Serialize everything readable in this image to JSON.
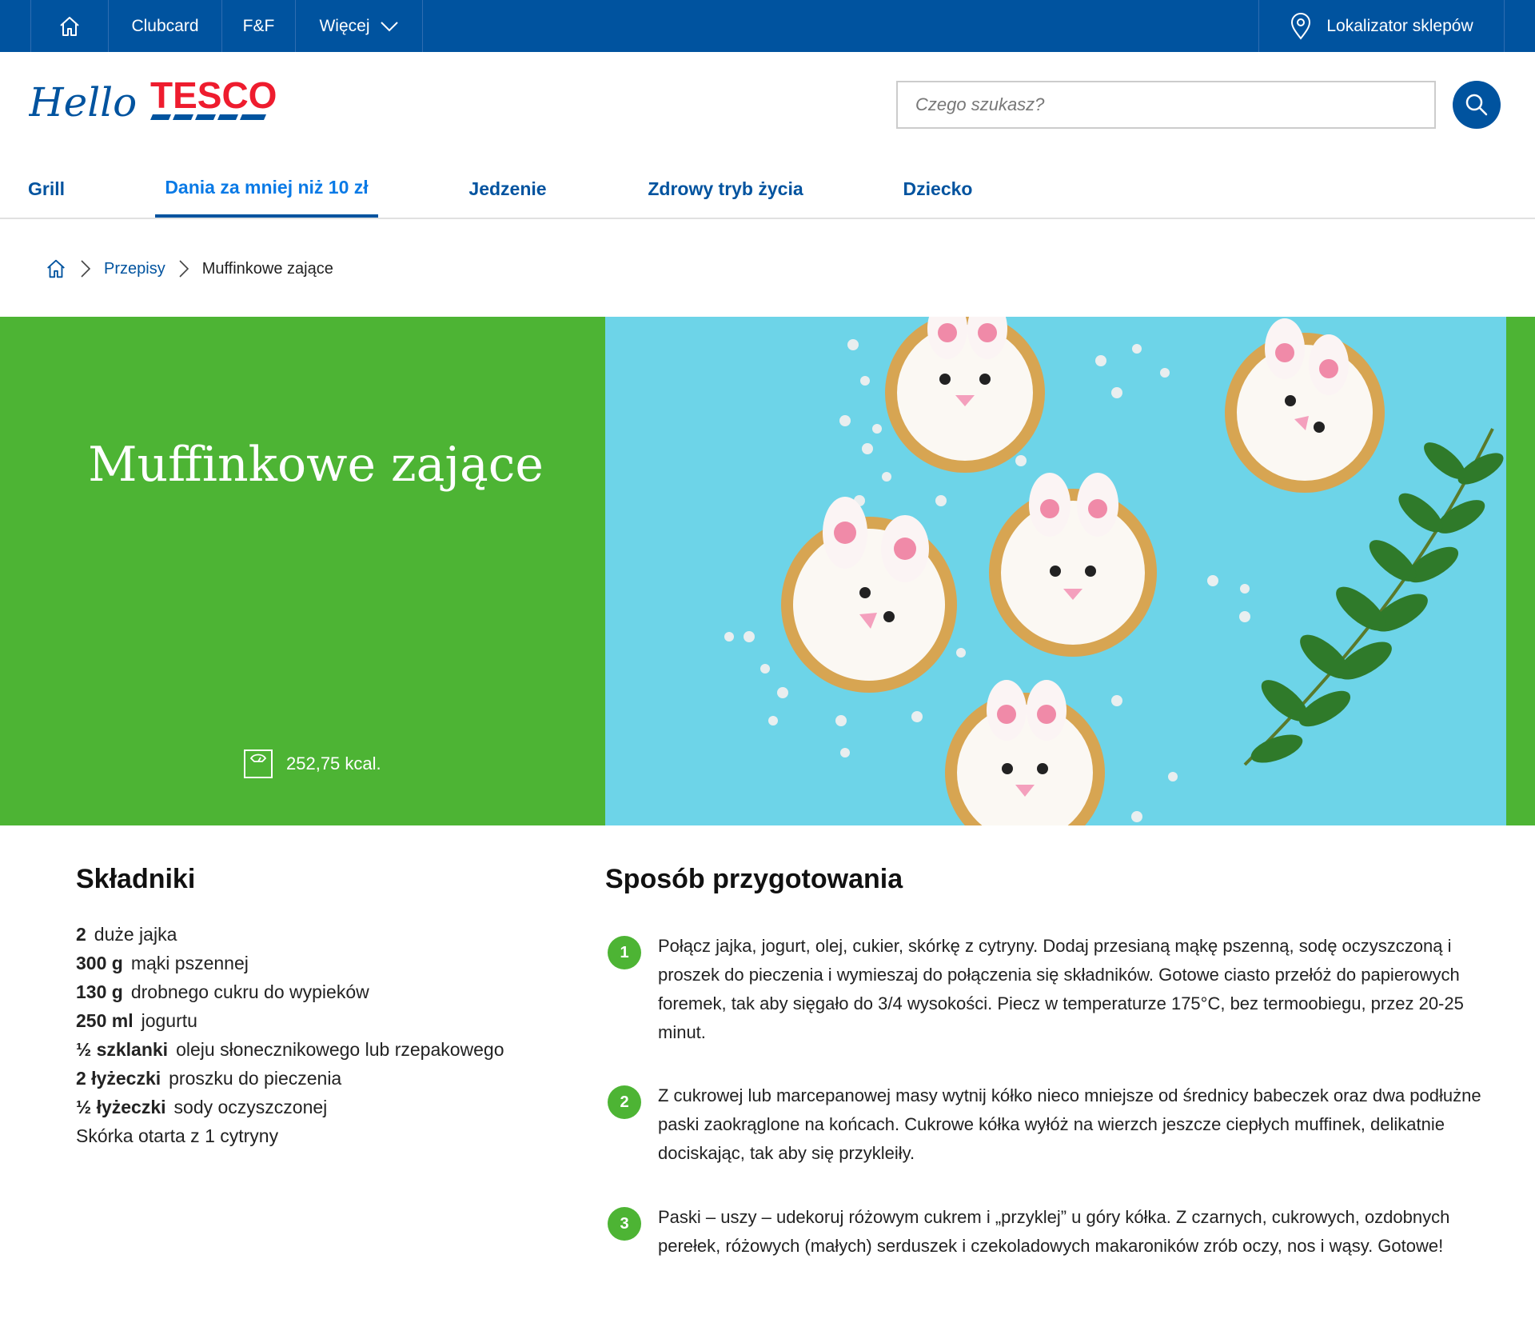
{
  "topbar": {
    "clubcard": "Clubcard",
    "ff": "F&F",
    "more": "Więcej",
    "store_locator": "Lokalizator sklepów"
  },
  "logo": {
    "hello": "Hello",
    "brand": "TESCO"
  },
  "search": {
    "placeholder": "Czego szukasz?"
  },
  "categories": [
    {
      "label": "Grill"
    },
    {
      "label": "Dania za mniej niż 10 zł"
    },
    {
      "label": "Jedzenie"
    },
    {
      "label": "Zdrowy tryb życia"
    },
    {
      "label": "Dziecko"
    }
  ],
  "active_category": "Dania za mniej niż 10 zł",
  "breadcrumb": {
    "recipes": "Przepisy",
    "current": "Muffinkowe zające"
  },
  "hero": {
    "title": "Muffinkowe zające",
    "kcal": "252,75 kcal.",
    "background": "#4db434",
    "image_background": "#6dd4e8"
  },
  "ingredients": {
    "title": "Składniki",
    "items": [
      {
        "qty": "2",
        "name": "duże jajka"
      },
      {
        "qty": "300 g",
        "name": "mąki pszennej"
      },
      {
        "qty": "130 g",
        "name": "drobnego cukru do wypieków"
      },
      {
        "qty": "250 ml",
        "name": "jogurtu"
      },
      {
        "qty": "½ szklanki",
        "name": "oleju słonecznikowego lub rzepakowego"
      },
      {
        "qty": "2 łyżeczki",
        "name": "proszku do pieczenia"
      },
      {
        "qty": "½ łyżeczki",
        "name": "sody oczyszczonej"
      },
      {
        "qty": "",
        "name": "Skórka otarta z 1 cytryny"
      }
    ]
  },
  "method": {
    "title": "Sposób przygotowania",
    "steps": [
      {
        "num": "1",
        "text": "Połącz jajka, jogurt, olej, cukier, skórkę z cytryny. Dodaj przesianą mąkę pszenną, sodę oczyszczoną i proszek do pieczenia i wymieszaj do połączenia się składników. Gotowe ciasto przełóż do papierowych foremek, tak aby sięgało do 3/4 wysokości. Piecz w temperaturze 175°C, bez termoobiegu, przez 20-25 minut."
      },
      {
        "num": "2",
        "text": "Z cukrowej lub marcepanowej masy wytnij kółko nieco mniejsze od średnicy babeczek oraz dwa podłużne paski zaokrąglone na końcach. Cukrowe kółka wyłóż na wierzch jeszcze ciepłych muffinek, delikatnie dociskając, tak aby się przykleiły."
      },
      {
        "num": "3",
        "text": "Paski – uszy – udekoruj różowym cukrem i „przyklej” u góry kółka. Z czarnych, cukrowych, ozdobnych perełek, różowych (małych) serduszek i czekoladowych makaroników zrób oczy, nos i wąsy. Gotowe!"
      }
    ]
  },
  "colors": {
    "brand_blue": "#00539f",
    "brand_red": "#ee1c2e",
    "accent_green": "#4db434"
  }
}
